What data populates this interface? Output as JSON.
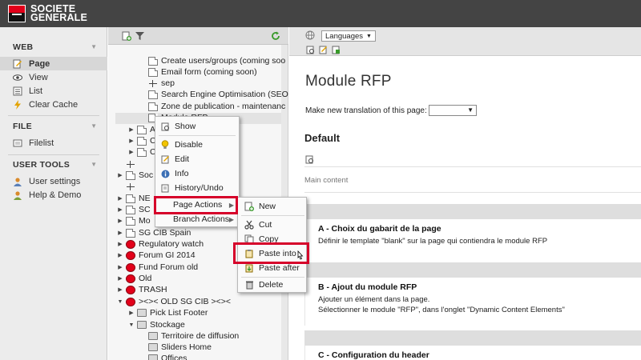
{
  "brand": {
    "line1": "SOCIETE",
    "line2": "GENERALE",
    "color": "#e2001a"
  },
  "sidebar": {
    "sections": [
      {
        "title": "WEB",
        "items": [
          {
            "label": "Page",
            "icon": "page-edit-icon",
            "active": true
          },
          {
            "label": "View",
            "icon": "eye-icon"
          },
          {
            "label": "List",
            "icon": "list-icon"
          },
          {
            "label": "Clear Cache",
            "icon": "lightning-icon"
          }
        ]
      },
      {
        "title": "FILE",
        "items": [
          {
            "label": "Filelist",
            "icon": "filelist-icon"
          }
        ]
      },
      {
        "title": "USER TOOLS",
        "items": [
          {
            "label": "User settings",
            "icon": "user-icon"
          },
          {
            "label": "Help & Demo",
            "icon": "help-icon"
          }
        ]
      }
    ]
  },
  "tree": {
    "rows": [
      {
        "label": "Create users/groups (coming soo",
        "icon": "page"
      },
      {
        "label": "Email form (coming soon)",
        "icon": "page"
      },
      {
        "label": "sep",
        "icon": "sep"
      },
      {
        "label": "Search Engine Optimisation (SEO",
        "icon": "page"
      },
      {
        "label": "Zone de publication - maintenanc",
        "icon": "page"
      },
      {
        "label": "Module RFP",
        "icon": "page"
      },
      {
        "label": "A",
        "icon": "page"
      },
      {
        "label": "C",
        "icon": "page"
      },
      {
        "label": "C",
        "icon": "page"
      },
      {
        "label": "",
        "icon": "sep"
      },
      {
        "label": "Soc",
        "icon": "page"
      },
      {
        "label": "",
        "icon": "sep"
      },
      {
        "label": "NE",
        "icon": "page"
      },
      {
        "label": "SC",
        "icon": "page"
      },
      {
        "label": "Mo",
        "icon": "page"
      },
      {
        "label": "SG CIB Spain",
        "icon": "page"
      },
      {
        "label": "Regulatory watch",
        "icon": "red"
      },
      {
        "label": "Forum GI 2014",
        "icon": "red"
      },
      {
        "label": "Fund Forum old",
        "icon": "red"
      },
      {
        "label": "Old",
        "icon": "red"
      },
      {
        "label": "TRASH",
        "icon": "red"
      },
      {
        "label": "><>< OLD SG CIB ><><",
        "icon": "red"
      },
      {
        "label": "Pick List Footer",
        "icon": "folder"
      },
      {
        "label": "Stockage",
        "icon": "folder"
      },
      {
        "label": "Territoire de diffusion",
        "icon": "folder"
      },
      {
        "label": "Sliders Home",
        "icon": "folder"
      },
      {
        "label": "Offices",
        "icon": "folder"
      }
    ]
  },
  "context_menu": {
    "items": [
      "Show",
      "Disable",
      "Edit",
      "Info",
      "History/Undo",
      "Page Actions",
      "Branch Actions"
    ]
  },
  "submenu": {
    "items": [
      "New",
      "Cut",
      "Copy",
      "Paste into",
      "Paste after",
      "Delete"
    ]
  },
  "right_toolbar": {
    "language": "Languages"
  },
  "content": {
    "title": "Module RFP",
    "translation_label": "Make new translation of this page:",
    "translation_value": "",
    "section": "Default",
    "column_label": "Main content",
    "blocks": [
      {
        "title": "A - Choix du gabarit de la page",
        "lines": [
          "Définir le template \"blank\" sur la page qui contiendra le module RFP"
        ]
      },
      {
        "title": "B - Ajout du module RFP",
        "lines": [
          "Ajouter un élément dans la page.",
          "Sélectionner le module \"RFP\", dans l'onglet \"Dynamic Content Elements\""
        ]
      },
      {
        "title": "C - Configuration du header",
        "lines": []
      }
    ]
  },
  "colors": {
    "highlight": "#d6002a",
    "topbar": "#444444"
  }
}
